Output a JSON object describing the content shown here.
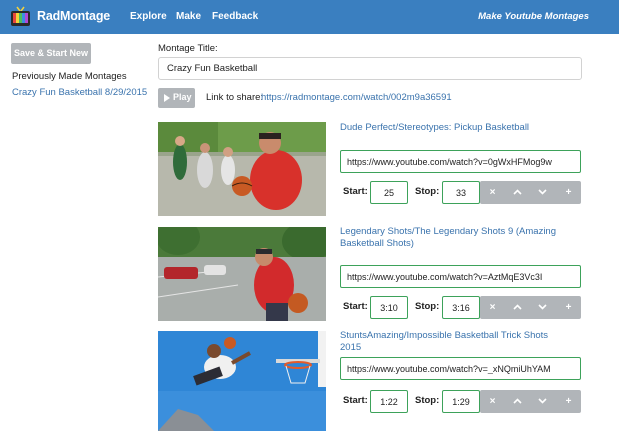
{
  "app": {
    "name": "RadMontage",
    "tagline": "Make Youtube Montages",
    "nav": [
      "Explore",
      "Make",
      "Feedback"
    ]
  },
  "sidebar": {
    "save_button": "Save & Start New",
    "previous_label": "Previously Made Montages",
    "previous_items": [
      "Crazy Fun Basketball 8/29/2015"
    ]
  },
  "montage": {
    "title_label": "Montage Title:",
    "title_value": "Crazy Fun Basketball",
    "play_label": "Play",
    "share_label": "Link to share:",
    "share_url": "https://radmontage.com/watch/002m9a36591"
  },
  "labels": {
    "start": "Start:",
    "stop": "Stop:"
  },
  "controls": {
    "remove": "×",
    "add": "+"
  },
  "clips": [
    {
      "title": "Dude Perfect/Stereotypes: Pickup Basketball",
      "url": "https://www.youtube.com/watch?v=0gWxHFMog9w",
      "start": "25",
      "stop": "33"
    },
    {
      "title": "Legendary Shots/The Legendary Shots 9 (Amazing Basketball Shots)",
      "url": "https://www.youtube.com/watch?v=AztMqE3Vc3I",
      "start": "3:10",
      "stop": "3:16"
    },
    {
      "title": "StuntsAmazing/Impossible Basketball Trick Shots 2015",
      "url": "https://www.youtube.com/watch?v=_xNQmiUhYAM",
      "start": "1:22",
      "stop": "1:29"
    }
  ],
  "colors": {
    "navbar": "#3a7fc0",
    "link": "#3a73ad",
    "button_gray": "#b1b5b9",
    "input_border_valid": "#3da25a"
  }
}
